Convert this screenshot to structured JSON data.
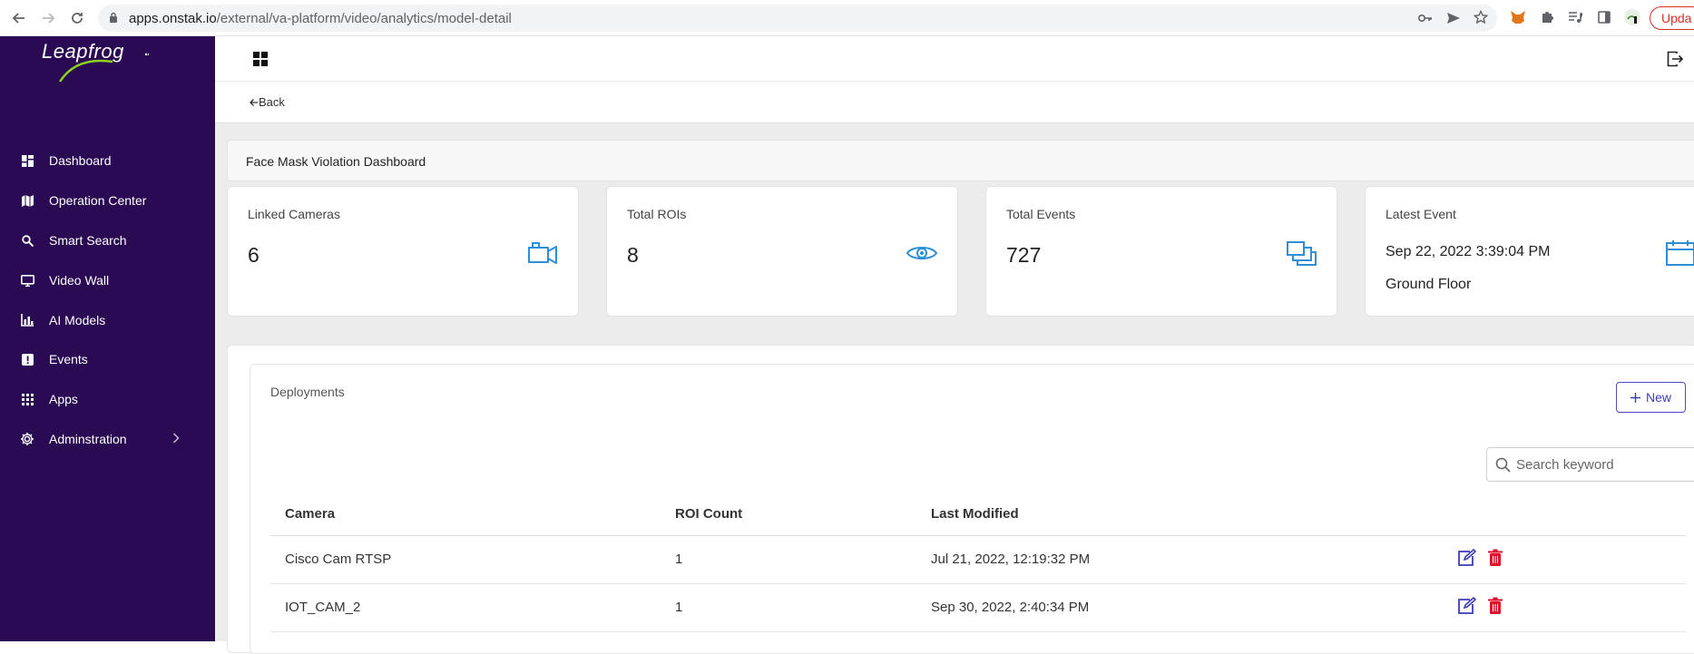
{
  "browser": {
    "url_host": "apps.onstak.io",
    "url_path": "/external/va-platform/video/analytics/model-detail",
    "update_label": "Upda"
  },
  "sidebar": {
    "logo": "Leapfrog",
    "items": [
      {
        "label": "Dashboard",
        "icon": "dashboard-icon"
      },
      {
        "label": "Operation Center",
        "icon": "map-icon"
      },
      {
        "label": "Smart Search",
        "icon": "search-icon"
      },
      {
        "label": "Video Wall",
        "icon": "monitor-icon"
      },
      {
        "label": "AI Models",
        "icon": "chart-icon"
      },
      {
        "label": "Events",
        "icon": "alert-icon"
      },
      {
        "label": "Apps",
        "icon": "apps-grid-icon"
      },
      {
        "label": "Adminstration",
        "icon": "gear-icon"
      }
    ]
  },
  "back_label": "Back",
  "page_title": "Face Mask Violation Dashboard",
  "cards": {
    "linked_cameras": {
      "label": "Linked Cameras",
      "value": "6"
    },
    "total_rois": {
      "label": "Total ROIs",
      "value": "8"
    },
    "total_events": {
      "label": "Total Events",
      "value": "727"
    },
    "latest_event": {
      "label": "Latest Event",
      "time": "Sep 22, 2022 3:39:04 PM",
      "location": "Ground Floor"
    }
  },
  "deployments": {
    "title": "Deployments",
    "new_label": "New",
    "search_placeholder": "Search keyword",
    "columns": [
      "Camera",
      "ROI Count",
      "Last Modified"
    ],
    "rows": [
      {
        "camera": "Cisco Cam RTSP",
        "roi": "1",
        "modified": "Jul 21, 2022, 12:19:32 PM"
      },
      {
        "camera": "IOT_CAM_2",
        "roi": "1",
        "modified": "Sep 30, 2022, 2:40:34 PM"
      }
    ]
  },
  "colors": {
    "sidebar": "#2a0a52",
    "accent_blue": "#2e8fd6",
    "edit": "#3d3cb8",
    "delete": "#e0102f"
  }
}
